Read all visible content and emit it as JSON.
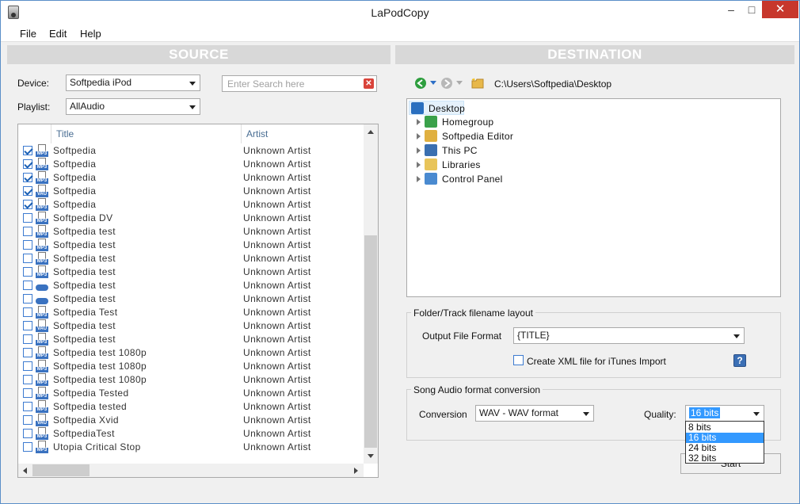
{
  "window": {
    "title": "LaPodCopy",
    "minimize": "–",
    "maximize": "□",
    "close": "✕"
  },
  "menu": [
    "File",
    "Edit",
    "Help"
  ],
  "source": {
    "header": "SOURCE",
    "device_label": "Device:",
    "device_value": "Softpedia iPod",
    "playlist_label": "Playlist:",
    "playlist_value": "AllAudio",
    "search_placeholder": "Enter Search here",
    "columns": [
      "Title",
      "Artist"
    ],
    "tracks": [
      {
        "checked": true,
        "type": "MP3",
        "title": "Softpedia",
        "artist": "Unknown Artist"
      },
      {
        "checked": true,
        "type": "MP3",
        "title": "Softpedia",
        "artist": "Unknown Artist"
      },
      {
        "checked": true,
        "type": "MP3",
        "title": "Softpedia",
        "artist": "Unknown Artist"
      },
      {
        "checked": true,
        "type": "VAU",
        "title": "Softpedia",
        "artist": "Unknown Artist"
      },
      {
        "checked": true,
        "type": "MP3",
        "title": "Softpedia",
        "artist": "Unknown Artist"
      },
      {
        "checked": false,
        "type": "MP3",
        "title": "Softpedia DV",
        "artist": "Unknown Artist"
      },
      {
        "checked": false,
        "type": "MP3",
        "title": "Softpedia test",
        "artist": "Unknown Artist"
      },
      {
        "checked": false,
        "type": "MP3",
        "title": "Softpedia test",
        "artist": "Unknown Artist"
      },
      {
        "checked": false,
        "type": "MP3",
        "title": "Softpedia test",
        "artist": "Unknown Artist"
      },
      {
        "checked": false,
        "type": "MP3",
        "title": "Softpedia test",
        "artist": "Unknown Artist"
      },
      {
        "checked": false,
        "type": "",
        "title": "Softpedia test",
        "artist": "Unknown Artist"
      },
      {
        "checked": false,
        "type": "",
        "title": "Softpedia test",
        "artist": "Unknown Artist"
      },
      {
        "checked": false,
        "type": "MP3",
        "title": "Softpedia Test",
        "artist": "Unknown Artist"
      },
      {
        "checked": false,
        "type": "VAU",
        "title": "Softpedia test",
        "artist": "Unknown Artist"
      },
      {
        "checked": false,
        "type": "MP3",
        "title": "Softpedia test",
        "artist": "Unknown Artist"
      },
      {
        "checked": false,
        "type": "MP3",
        "title": "Softpedia test 1080p",
        "artist": "Unknown Artist"
      },
      {
        "checked": false,
        "type": "MP3",
        "title": "Softpedia test 1080p",
        "artist": "Unknown Artist"
      },
      {
        "checked": false,
        "type": "MP3",
        "title": "Softpedia test 1080p",
        "artist": "Unknown Artist"
      },
      {
        "checked": false,
        "type": "MP3",
        "title": "Softpedia Tested",
        "artist": "Unknown Artist"
      },
      {
        "checked": false,
        "type": "MP3",
        "title": "Softpedia tested",
        "artist": "Unknown Artist"
      },
      {
        "checked": false,
        "type": "VAU",
        "title": "Softpedia Xvid",
        "artist": "Unknown Artist"
      },
      {
        "checked": false,
        "type": "MP3",
        "title": "SoftpediaTest",
        "artist": "Unknown Artist"
      },
      {
        "checked": false,
        "type": "MP3",
        "title": "Utopia Critical Stop",
        "artist": "Unknown Artist"
      }
    ]
  },
  "destination": {
    "header": "DESTINATION",
    "path": "C:\\Users\\Softpedia\\Desktop",
    "tree": [
      {
        "label": "Desktop",
        "icon": "desktop-icon",
        "selected": true
      },
      {
        "label": "Homegroup",
        "icon": "homegroup-icon"
      },
      {
        "label": "Softpedia Editor",
        "icon": "user-folder-icon"
      },
      {
        "label": "This PC",
        "icon": "computer-icon"
      },
      {
        "label": "Libraries",
        "icon": "libraries-icon"
      },
      {
        "label": "Control Panel",
        "icon": "control-panel-icon"
      }
    ],
    "layout_group_title": "Folder/Track filename layout",
    "output_format_label": "Output File Format",
    "output_format_value": "{TITLE}",
    "xml_checkbox_label": "Create XML file for iTunes Import",
    "help_label": "?",
    "conversion_group_title": "Song Audio format conversion",
    "conversion_label": "Conversion",
    "conversion_value": "WAV - WAV format",
    "quality_label": "Quality:",
    "quality_value": "16 bits",
    "quality_options": [
      "8 bits",
      "16 bits",
      "24 bits",
      "32 bits"
    ],
    "quality_selected_index": 1,
    "start_label": "Start"
  },
  "colors": {
    "accent": "#3399ff",
    "header_bg": "#d8d8d8",
    "close_red": "#c7372c",
    "nav_green": "#2e9e3e"
  }
}
